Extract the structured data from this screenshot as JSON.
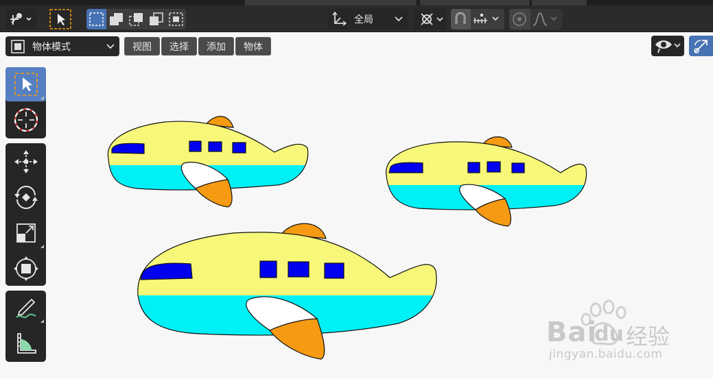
{
  "toolbar": {
    "orientation_label": "全局",
    "icons": [
      "transform-gizmo-icon",
      "select-tool-icon",
      "select-box-new-icon",
      "select-box-extend-icon",
      "select-box-subtract-icon",
      "select-box-intersect-icon",
      "orientation-axes-icon",
      "pivot-point-icon",
      "snapping-icon",
      "snap-increment-icon",
      "proportional-edit-icon",
      "falloff-curve-icon"
    ]
  },
  "header": {
    "mode_label": "物体模式",
    "menus": [
      "视图",
      "选择",
      "添加",
      "物体"
    ],
    "right_icons": [
      "visibility-eye-icon",
      "gizmo-toggle-icon"
    ]
  },
  "toolshelf": {
    "tools": [
      "select-box",
      "cursor",
      "move",
      "rotate",
      "scale",
      "transform",
      "annotate",
      "measure"
    ]
  },
  "viewport": {
    "objects": [
      "airplane-1",
      "airplane-2",
      "airplane-3"
    ],
    "colors": {
      "fuselage_top": "#f7f77a",
      "fuselage_bottom": "#00f1f5",
      "window": "#0000ee",
      "fin": "#f59a12",
      "outline": "#111111"
    }
  },
  "watermark": {
    "brand": "Bai",
    "brand2": "du",
    "cn": "经验",
    "url": "jingyan.baidu.com"
  }
}
